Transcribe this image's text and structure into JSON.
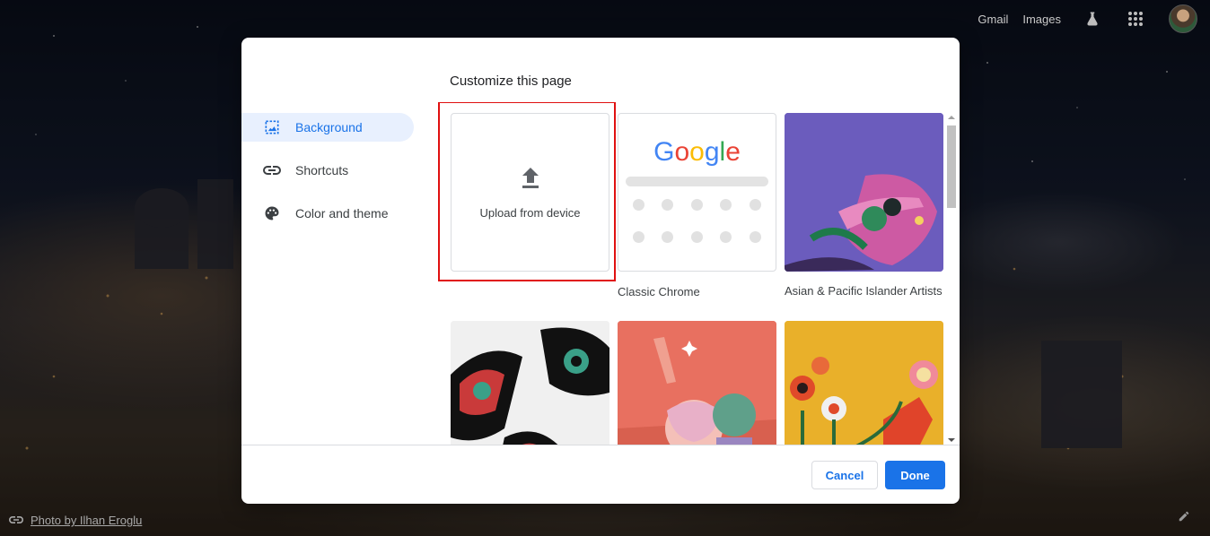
{
  "topbar": {
    "gmail": "Gmail",
    "images": "Images",
    "labs_icon": "flask-icon",
    "apps_icon": "apps-grid-icon",
    "avatar_icon": "profile-avatar"
  },
  "attribution": {
    "icon": "link-icon",
    "text": "Photo by Ilhan Eroglu"
  },
  "dialog": {
    "title": "Customize this page",
    "sidebar": [
      {
        "label": "Background",
        "icon": "image-icon",
        "active": true
      },
      {
        "label": "Shortcuts",
        "icon": "link-icon",
        "active": false
      },
      {
        "label": "Color and theme",
        "icon": "palette-icon",
        "active": false
      }
    ],
    "tiles": {
      "upload": {
        "label": "Upload from device",
        "icon": "upload-icon"
      },
      "classic": {
        "label": "Classic Chrome",
        "logo": "Google"
      },
      "aapi": {
        "label": "Asian & Pacific Islander Artists"
      }
    },
    "buttons": {
      "cancel": "Cancel",
      "done": "Done"
    }
  },
  "colors": {
    "accent": "#1a73e8",
    "highlight": "#e01010",
    "active_bg": "#e8f0fe"
  }
}
